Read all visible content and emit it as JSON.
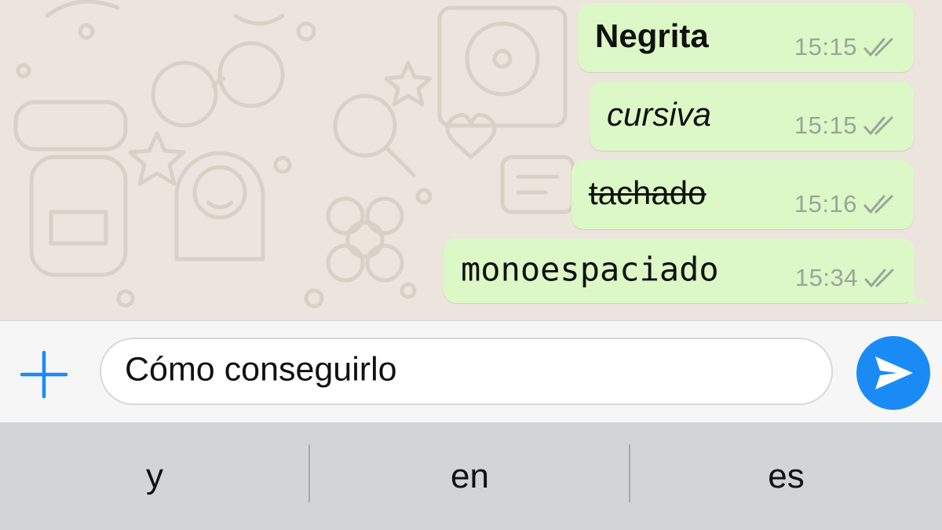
{
  "messages": [
    {
      "text": "Negrita",
      "time": "15:15",
      "style": "bold"
    },
    {
      "text": "cursiva",
      "time": "15:15",
      "style": "italic"
    },
    {
      "text": "tachado",
      "time": "15:16",
      "style": "strikethrough"
    },
    {
      "text": "monoespaciado",
      "time": "15:34",
      "style": "monospace"
    }
  ],
  "input": {
    "value": "Cómo conseguirlo"
  },
  "suggestions": [
    "y",
    "en",
    "es"
  ],
  "colors": {
    "chat_background": "#ece5dd",
    "outgoing_bubble": "#dcf8c6",
    "accent": "#1a8bf5",
    "keyboard_bar": "#d3d4d8"
  },
  "icons": {
    "attach": "plus-icon",
    "send": "paper-plane-icon",
    "read_status": "double-check-icon"
  }
}
